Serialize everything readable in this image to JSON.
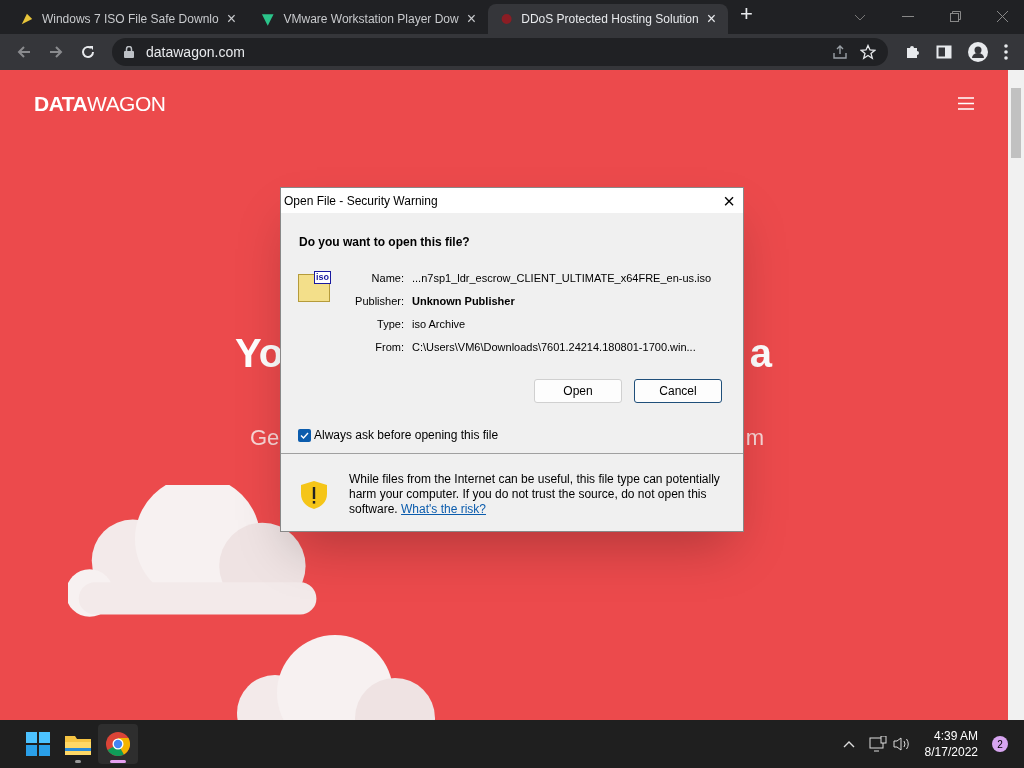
{
  "browser": {
    "tabs": [
      {
        "title": "Windows 7 ISO File Safe Downlo",
        "selected": false,
        "close": "×"
      },
      {
        "title": "VMware Workstation Player Dow",
        "selected": false,
        "close": "×"
      },
      {
        "title": "DDoS Protected Hosting Solution",
        "selected": true,
        "close": "×"
      }
    ],
    "new_tab": "+",
    "address": "datawagon.com"
  },
  "page": {
    "logo_bold": "DATA",
    "logo_light": "WAGON",
    "hero_title_left": "Yo",
    "hero_title_right": "a",
    "hero_sub_left": "Ge",
    "hero_sub_right": "m"
  },
  "dialog": {
    "title": "Open File - Security Warning",
    "close": "×",
    "question": "Do you want to open this file?",
    "file_icon_text": "iso",
    "fields": [
      {
        "label": "Name:",
        "value": "...n7sp1_ldr_escrow_CLIENT_ULTIMATE_x64FRE_en-us.iso",
        "bold": false
      },
      {
        "label": "Publisher:",
        "value": "Unknown Publisher",
        "bold": true
      },
      {
        "label": "Type:",
        "value": "iso Archive",
        "bold": false
      },
      {
        "label": "From:",
        "value": "C:\\Users\\VM6\\Downloads\\7601.24214.180801-1700.win...",
        "bold": false
      }
    ],
    "buttons": [
      {
        "label": "Open",
        "selected": false
      },
      {
        "label": "Cancel",
        "selected": true
      }
    ],
    "always_ask": {
      "label": "Always ask before opening this file",
      "checked": true
    },
    "warning": "While files from the Internet can be useful, this file type can potentially harm your computer. If you do not trust the source, do not open this software.",
    "risk_link": "What's the risk?"
  },
  "taskbar": {
    "apps": [
      {
        "kind": "start",
        "active": false
      },
      {
        "kind": "folder",
        "active": false,
        "running": true
      },
      {
        "kind": "chrome",
        "active": true,
        "running": true
      }
    ],
    "time": "4:39 AM",
    "date": "8/17/2022",
    "badge": "2"
  }
}
